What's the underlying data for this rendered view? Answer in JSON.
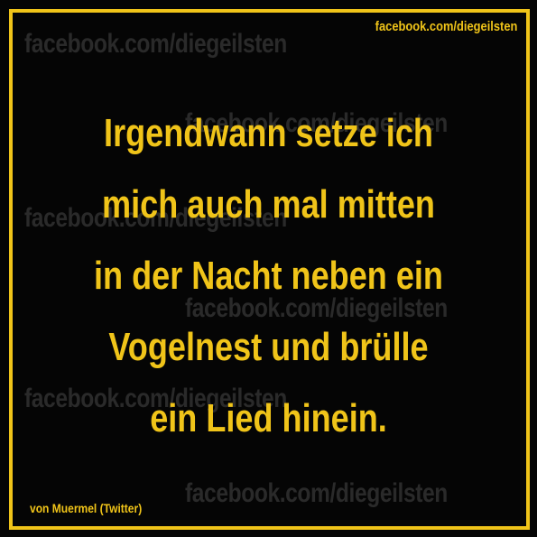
{
  "watermark": {
    "text": "facebook.com/diegeilsten"
  },
  "header": {
    "source_link": "facebook.com/diegeilsten"
  },
  "quote": {
    "lines": [
      "Irgendwann setze ich",
      "mich auch mal mitten",
      "in der Nacht neben ein",
      "Vogelnest und brülle",
      "ein Lied hinein."
    ]
  },
  "footer": {
    "credit": "von Muermel (Twitter)"
  },
  "colors": {
    "background": "#050505",
    "accent": "#f0c419",
    "watermark": "#2a2a2a"
  }
}
